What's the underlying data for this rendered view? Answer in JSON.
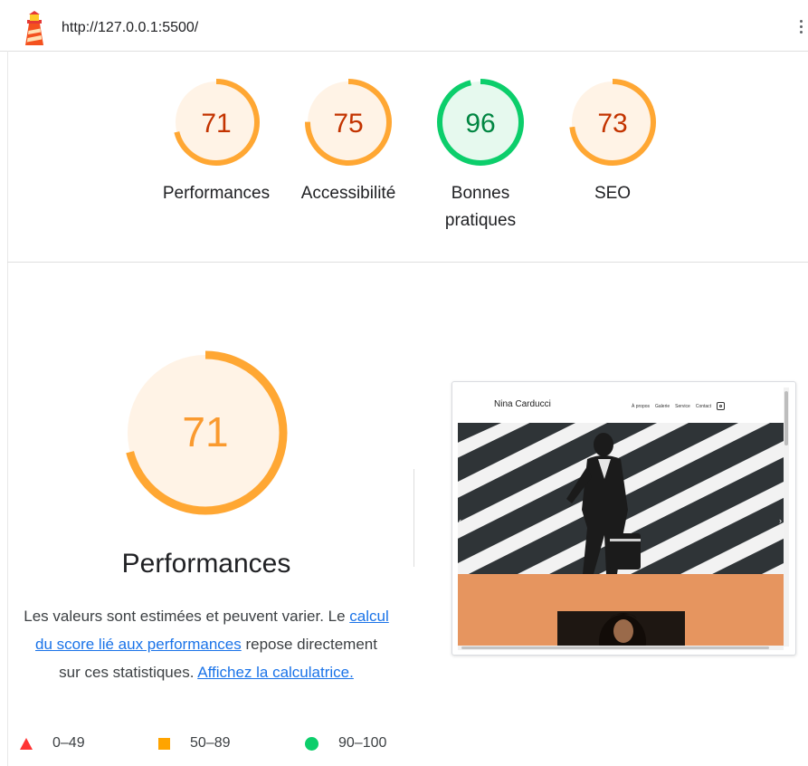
{
  "topbar": {
    "url": "http://127.0.0.1:5500/"
  },
  "gauges": [
    {
      "label": "Performances",
      "score": "71",
      "value": 71,
      "status": "average"
    },
    {
      "label": "Accessibilité",
      "score": "75",
      "value": 75,
      "status": "average"
    },
    {
      "label": "Bonnes pratiques",
      "score": "96",
      "value": 96,
      "status": "pass"
    },
    {
      "label": "SEO",
      "score": "73",
      "value": 73,
      "status": "average"
    }
  ],
  "performance": {
    "score": "71",
    "value": 71,
    "title": "Performances",
    "desc_1": "Les valeurs sont estimées et peuvent varier. Le ",
    "link_1": "calcul du score lié aux performances",
    "desc_2": " repose directement sur ces statistiques. ",
    "link_2": "Affichez la calculatrice."
  },
  "screenshot": {
    "site_name": "Nina Carducci",
    "nav": [
      "À propos",
      "Galerie",
      "Service",
      "Contact"
    ]
  },
  "legend": [
    {
      "range": "0–49",
      "shape": "triangle"
    },
    {
      "range": "50–89",
      "shape": "square"
    },
    {
      "range": "90–100",
      "shape": "circle"
    }
  ],
  "colors": {
    "average_stroke": "#ffa733",
    "average_fill": "#fff3e6",
    "average_text": "#c33300",
    "big_text": "#fa9a2f",
    "pass_stroke": "#0cce6b",
    "pass_fill": "#e6f9ee",
    "pass_text": "#018642",
    "fail": "#ff3333",
    "link": "#1a73e8"
  }
}
